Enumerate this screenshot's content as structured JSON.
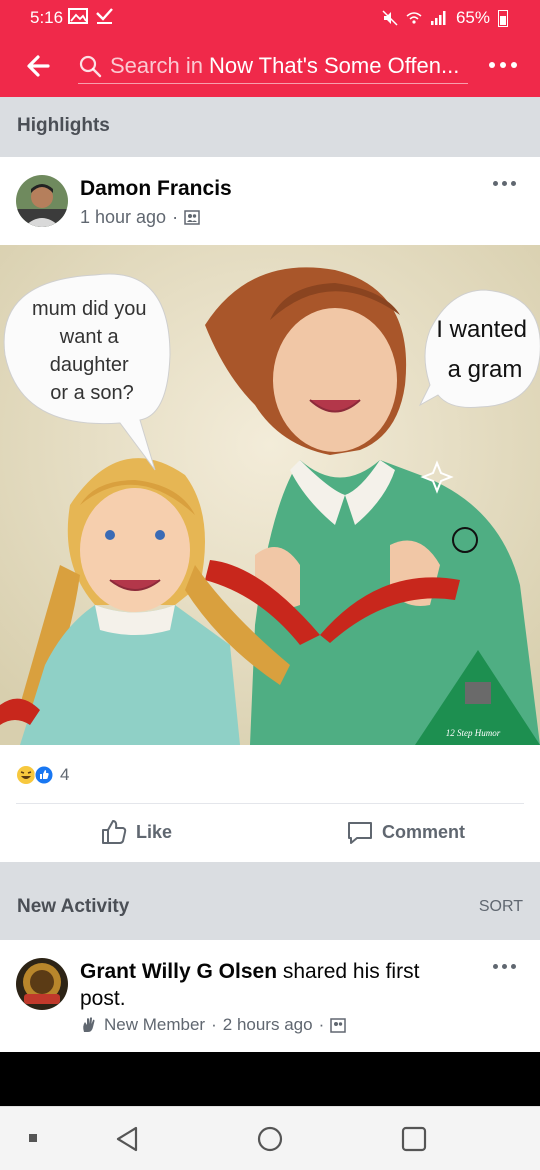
{
  "status": {
    "time": "5:16",
    "battery": "65%"
  },
  "header": {
    "search_prefix": "Search in",
    "group_name": "Now That's Some Offen..."
  },
  "highlights": {
    "label": "Highlights"
  },
  "post": {
    "author": "Damon Francis",
    "time": "1 hour ago",
    "meme": {
      "bubble_left": [
        "mum did you",
        "want a",
        "daughter",
        "or a son?"
      ],
      "bubble_right": [
        "I wanted",
        "a gram"
      ],
      "watermark": "12 Step Humor"
    },
    "reaction_count": "4",
    "like_label": "Like",
    "comment_label": "Comment"
  },
  "new_activity": {
    "label": "New Activity",
    "sort_label": "SORT"
  },
  "activity": {
    "author": "Grant Willy G Olsen",
    "text": " shared his first post.",
    "badge": "New Member",
    "time": "2 hours ago"
  },
  "colors": {
    "brand": "#f0294a",
    "muted": "#606770"
  }
}
